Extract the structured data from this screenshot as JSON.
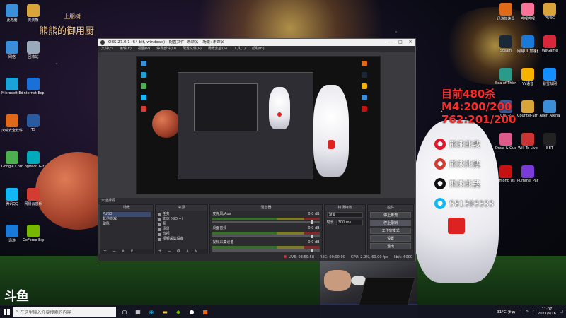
{
  "overlay": {
    "subtitle": "上朋树",
    "title": "熊熊的御用厨"
  },
  "stats": {
    "line1": "目前480杀",
    "line2": "M4:200/200",
    "line3": "762:201/200"
  },
  "social": [
    {
      "icon": "weibo-icon",
      "text": "熊熊熊我",
      "color": "#e6162d"
    },
    {
      "icon": "netease-icon",
      "text": "熊熊熊我",
      "color": "#d43c33"
    },
    {
      "icon": "tiktok-icon",
      "text": "熊熊熊我",
      "color": "#111111"
    },
    {
      "icon": "qq-icon",
      "text": "581393333",
      "color": "#12b7f5"
    }
  ],
  "watermark": "斗鱼",
  "desktop_left": [
    {
      "label": "此电脑",
      "color": "#3b8fd9"
    },
    {
      "label": "天天熊",
      "color": "#d9a53b"
    },
    {
      "label": "网络",
      "color": "#3b8fd9"
    },
    {
      "label": "回收站",
      "color": "#9ab"
    },
    {
      "label": "Microsoft Edge",
      "color": "#1aa3d9"
    },
    {
      "label": "Internet Explorer",
      "color": "#1a6fd9"
    },
    {
      "label": "火绒安全软件",
      "color": "#e06a1a"
    },
    {
      "label": "TS",
      "color": "#2a5aa0"
    },
    {
      "label": "Google Chrome",
      "color": "#4caf50"
    },
    {
      "label": "Logitech G HUB",
      "color": "#0ab"
    },
    {
      "label": "腾讯QQ",
      "color": "#12b7f5"
    },
    {
      "label": "网易云音乐",
      "color": "#d43c33"
    },
    {
      "label": "迅游",
      "color": "#1a7ad9"
    },
    {
      "label": "GeForce Experience",
      "color": "#76b900"
    }
  ],
  "desktop_right": [
    {
      "label": "迅游加速器",
      "color": "#e06a1a"
    },
    {
      "label": "哔哩哔哩",
      "color": "#fb7299"
    },
    {
      "label": "PUBG",
      "color": "#d9a53b"
    },
    {
      "label": "Steam",
      "color": "#1b2838"
    },
    {
      "label": "网易UU加速器",
      "color": "#1a7ad9"
    },
    {
      "label": "WeGame",
      "color": "#d9263b"
    },
    {
      "label": "Sea of Thieves",
      "color": "#2a9a8a"
    },
    {
      "label": "YY语音",
      "color": "#f5b300"
    },
    {
      "label": "暴雪战网",
      "color": "#148eff"
    },
    {
      "label": "CPU-Z",
      "color": "#3b5a9a"
    },
    {
      "label": "Counter-Strike",
      "color": "#d9a53b"
    },
    {
      "label": "Alien Arena",
      "color": "#3b8fd9"
    },
    {
      "label": "Draw & Guess",
      "color": "#e05a8a"
    },
    {
      "label": "Will To Live",
      "color": "#c33"
    },
    {
      "label": "BBT",
      "color": "#222"
    },
    {
      "label": "Among Us",
      "color": "#c51111"
    },
    {
      "label": "Pummel Party",
      "color": "#7a3bd9"
    }
  ],
  "obs": {
    "title": "OBS 27.0.1 (64-bit, windows) - 配置文件: 未命名 - 场景: 未命名",
    "menu": [
      "文件(F)",
      "编辑(E)",
      "视图(V)",
      "停靠部件(D)",
      "配置文件(P)",
      "场景集合(S)",
      "工具(T)",
      "帮助(H)"
    ],
    "dock_bar_label": "未选择源",
    "docks": {
      "scenes": {
        "header": "场景",
        "items": [
          "PUBG",
          "其他游戏",
          "聊队"
        ],
        "selected": 0,
        "footer": "+ − ∧ ∨"
      },
      "sources": {
        "header": "来源",
        "items": [
          "任务",
          "文本 (GDI+)",
          "图",
          "场景",
          "音视",
          "视频采集设备"
        ],
        "footer": "+ − ⚙ ∧ ∨"
      },
      "mixer": {
        "header": "混音器",
        "channels": [
          {
            "name": "麦克风/Aux",
            "db": "0.0 dB"
          },
          {
            "name": "桌面音频",
            "db": "0.0 dB"
          },
          {
            "name": "视频采集设备",
            "db": "0.0 dB"
          }
        ]
      },
      "transitions": {
        "header": "转场特效",
        "type": "渐变",
        "duration_label": "时长",
        "duration": "300 ms"
      },
      "controls": {
        "header": "控件",
        "buttons": [
          "停止推流",
          "停止录制",
          "工作室模式",
          "设置",
          "退出"
        ]
      }
    },
    "status": {
      "live": "LIVE: 03:59:58",
      "rec": "REC: 00:00:00",
      "cpu": "CPU: 2.9%, 60.00 fps",
      "kbps": "kb/s: 6000"
    }
  },
  "taskbar": {
    "search_placeholder": "在这里输入你要搜索的内容",
    "weather": "31°C 多云",
    "time": "11:07",
    "date": "2021/9/16"
  }
}
